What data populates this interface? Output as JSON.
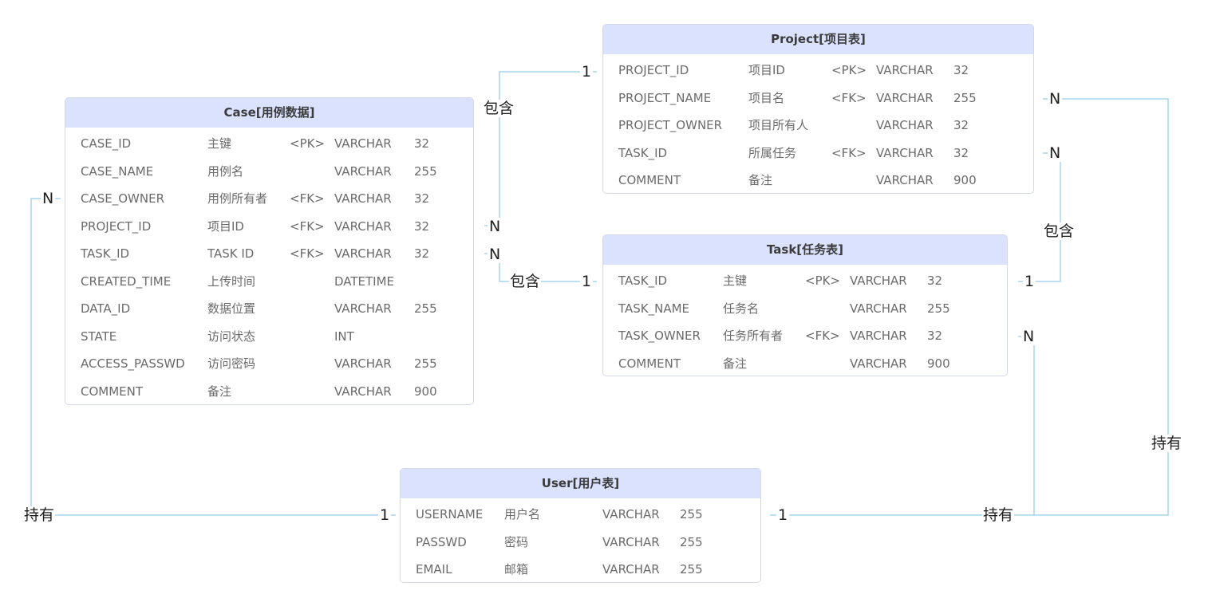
{
  "entities": {
    "case": {
      "title": "Case[用例数据]",
      "rows": [
        [
          "CASE_ID",
          "主键",
          "<PK>",
          "VARCHAR",
          "32"
        ],
        [
          "CASE_NAME",
          "用例名",
          "",
          "VARCHAR",
          "255"
        ],
        [
          "CASE_OWNER",
          "用例所有者",
          "<FK>",
          "VARCHAR",
          "32"
        ],
        [
          "PROJECT_ID",
          "项目ID",
          "<FK>",
          "VARCHAR",
          "32"
        ],
        [
          "TASK_ID",
          "TASK ID",
          "<FK>",
          "VARCHAR",
          "32"
        ],
        [
          "CREATED_TIME",
          "上传时间",
          "",
          "DATETIME",
          ""
        ],
        [
          "DATA_ID",
          "数据位置",
          "",
          "VARCHAR",
          "255"
        ],
        [
          "STATE",
          "访问状态",
          "",
          "INT",
          ""
        ],
        [
          "ACCESS_PASSWD",
          "访问密码",
          "",
          "VARCHAR",
          "255"
        ],
        [
          "COMMENT",
          "备注",
          "",
          "VARCHAR",
          "900"
        ]
      ]
    },
    "project": {
      "title": "Project[项目表]",
      "rows": [
        [
          "PROJECT_ID",
          "项目ID",
          "<PK>",
          "VARCHAR",
          "32"
        ],
        [
          "PROJECT_NAME",
          "项目名",
          "<FK>",
          "VARCHAR",
          "255"
        ],
        [
          "PROJECT_OWNER",
          "项目所有人",
          "",
          "VARCHAR",
          "32"
        ],
        [
          "TASK_ID",
          "所属任务",
          "<FK>",
          "VARCHAR",
          "32"
        ],
        [
          "COMMENT",
          "备注",
          "",
          "VARCHAR",
          "900"
        ]
      ]
    },
    "task": {
      "title": "Task[任务表]",
      "rows": [
        [
          "TASK_ID",
          "主键",
          "<PK>",
          "VARCHAR",
          "32"
        ],
        [
          "TASK_NAME",
          "任务名",
          "",
          "VARCHAR",
          "255"
        ],
        [
          "TASK_OWNER",
          "任务所有者",
          "<FK>",
          "VARCHAR",
          "32"
        ],
        [
          "COMMENT",
          "备注",
          "",
          "VARCHAR",
          "900"
        ]
      ]
    },
    "user": {
      "title": "User[用户表]",
      "rows": [
        [
          "USERNAME",
          "用户名",
          "VARCHAR",
          "255"
        ],
        [
          "PASSWD",
          "密码",
          "VARCHAR",
          "255"
        ],
        [
          "EMAIL",
          "邮箱",
          "VARCHAR",
          "255"
        ]
      ]
    }
  },
  "relations": {
    "case_project": {
      "label": "包含",
      "card_from": "N",
      "card_to": "1"
    },
    "case_task": {
      "label": "包含",
      "card_from": "N",
      "card_to": "1"
    },
    "project_task": {
      "label": "包含",
      "card_from": "N",
      "card_to": "1"
    },
    "user_case": {
      "label": "持有",
      "card_from": "1",
      "card_to": "N"
    },
    "user_task": {
      "label": "持有",
      "card_from": "1",
      "card_to": "N"
    },
    "user_project": {
      "label": "持有",
      "card_from": "1",
      "card_to": "N"
    }
  },
  "colors": {
    "header_bg": "#dbe2fd",
    "line": "#a9d3f0",
    "border": "#d4d8e4"
  }
}
